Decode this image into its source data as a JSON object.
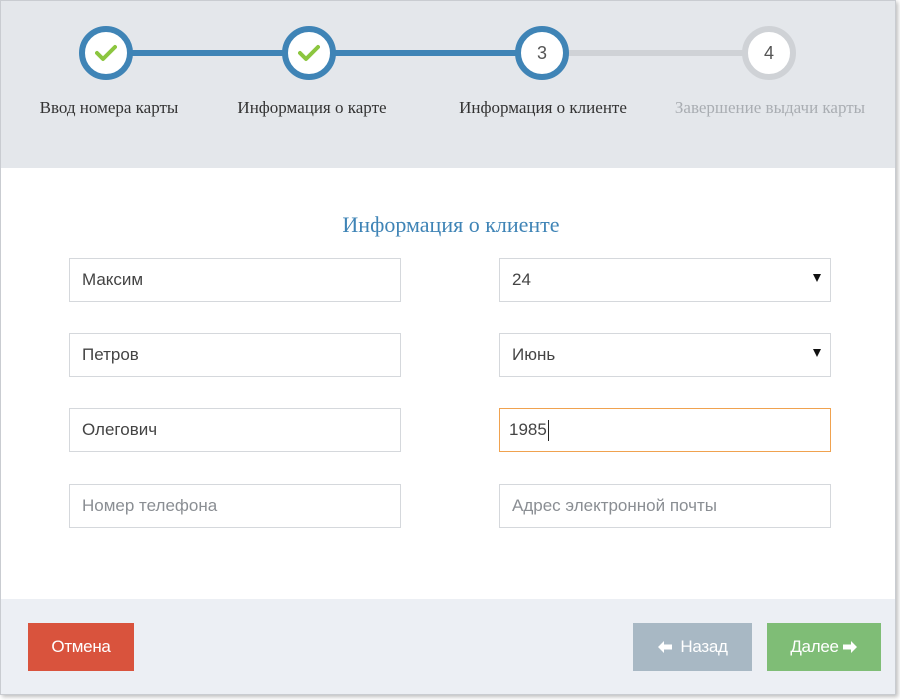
{
  "stepper": {
    "steps": [
      {
        "number": "1",
        "label": "Ввод номера карты",
        "state": "done"
      },
      {
        "number": "2",
        "label": "Информация о карте",
        "state": "done"
      },
      {
        "number": "3",
        "label": "Информация о клиенте",
        "state": "current"
      },
      {
        "number": "4",
        "label": "Завершение выдачи карты",
        "state": "todo"
      }
    ]
  },
  "form": {
    "title": "Информация о клиенте",
    "first_name": {
      "value": "Максим"
    },
    "last_name": {
      "value": "Петров"
    },
    "middle_name": {
      "value": "Олегович"
    },
    "phone": {
      "placeholder": "Номер телефона"
    },
    "birth_day": {
      "value": "24"
    },
    "birth_month": {
      "value": "Июнь"
    },
    "birth_year": {
      "value": "1985"
    },
    "email": {
      "placeholder": "Адрес электронной почты"
    }
  },
  "footer": {
    "cancel_label": "Отмена",
    "back_label": "Назад",
    "next_label": "Далее"
  },
  "icons": {
    "check": "check-icon",
    "back": "arrow-left-icon",
    "next": "arrow-right-icon",
    "dropdown": "dropdown-arrow-icon"
  },
  "colors": {
    "accent": "#3f84b6",
    "check": "#8cc63f",
    "cancel": "#d9533d",
    "back": "#a8b8c4",
    "next": "#7fbd76",
    "focus": "#f0a24f"
  }
}
